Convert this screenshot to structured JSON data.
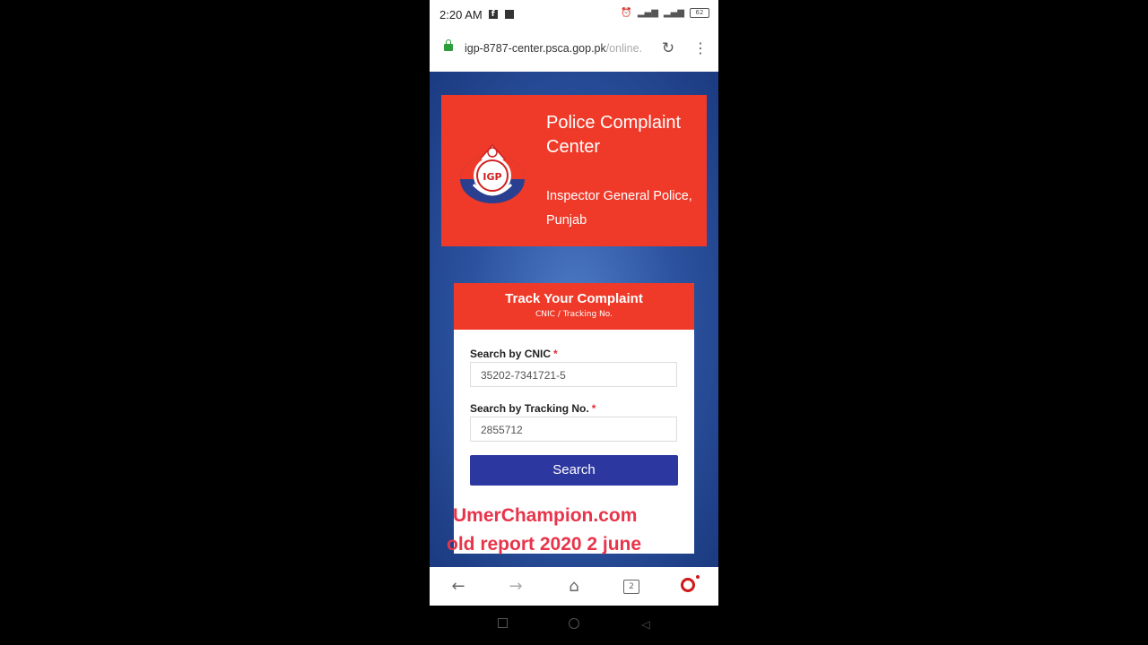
{
  "status_bar": {
    "time": "2:20 AM",
    "battery": "62"
  },
  "browser": {
    "url_host": "igp-8787-center.psca.gop.pk",
    "url_path": "/online.",
    "reload_icon": "reload-icon",
    "menu_icon": "kebab-menu-icon"
  },
  "header": {
    "title": "Police Complaint Center",
    "subtitle": "Inspector General Police, Punjab",
    "emblem_text": "IGP",
    "color": "#ef3a29"
  },
  "track": {
    "title": "Track Your Complaint",
    "subtitle": "CNIC / Tracking No.",
    "cnic_label": "Search by CNIC",
    "cnic_value": "35202-7341721-5",
    "tracking_label": "Search by Tracking No.",
    "tracking_value": "2855712",
    "required_mark": "*",
    "search_label": "Search",
    "button_color": "#2d37a0"
  },
  "watermark": {
    "line1": "UmerChampion.com",
    "line2": "old report 2020 2 june"
  },
  "bottom_nav": {
    "tabs_count": "2"
  }
}
